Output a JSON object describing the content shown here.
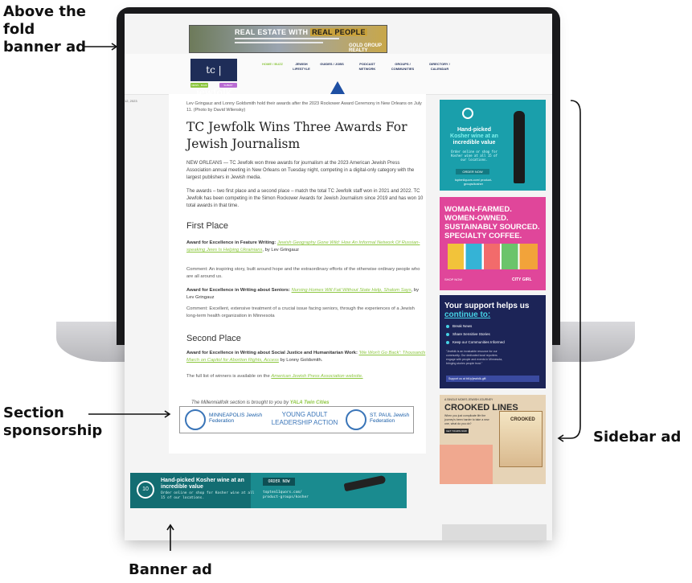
{
  "annotations": {
    "above_fold": "Above the fold banner ad",
    "section_sponsorship": "Section sponsorship",
    "sidebar_ad": "Sidebar ad",
    "banner_ad": "Banner ad"
  },
  "top_banner": {
    "headline_plain": "REAL ESTATE WITH",
    "headline_boxed": "REAL PEOPLE",
    "brand": "GOLD GROUP REALTY"
  },
  "site": {
    "logo_text": "tc | jewfolk",
    "nav": [
      {
        "label": "HOME / BUZZ"
      },
      {
        "label": "JEWISH LIFESTYLE"
      },
      {
        "label": "GUIDES / JOBS"
      },
      {
        "label": "PODCAST NETWORK"
      },
      {
        "label": "GROUPS / COMMUNITIES"
      },
      {
        "label": "DIRECTORY / CALENDAR"
      }
    ],
    "pill_green": "NEWS · BUZZ",
    "pill_purple": "SUBMIT"
  },
  "article": {
    "date": "12, 2023",
    "caption": "Lev Gringauz and Lonny Goldsmith hold their awards after the 2023 Rockower Award Ceremony in New Orleans on July 11. (Photo by David Wilensky)",
    "headline": "TC Jewfolk Wins Three Awards For Jewish Journalism",
    "p1": "NEW ORLEANS — TC Jewfolk won three awards for journalism at the 2023 American Jewish Press Association annual meeting in New Orleans on Tuesday night, competing in a digital-only category with the largest publishers in Jewish media.",
    "p2": "The awards – two first place and a second place – match the total TC Jewfolk staff won in 2021 and 2022. TC Jewfolk has been competing in the Simon Rockower Awards for Jewish Journalism since 2019 and has won 10 total awards in that time.",
    "first_place": "First Place",
    "award1_label": "Award for Excellence in Feature Writing:",
    "award1_link": "Jewish Geography Gone Wild: How An Informal Network Of Russian-speaking Jews Is Helping Ukrainians",
    "award1_by": ", by Lev Gringauz",
    "comment1": "Comment: An inspiring story, built around hope and the extraordinary efforts of the otherwise ordinary people who are all around us.",
    "award2_label": "Award for Excellence in Writing about Seniors:",
    "award2_link": "Nursing Homes Will Fail Without State Help, Shalom Says",
    "award2_by": ", by Lev Gringauz",
    "comment2": "Comment: Excellent, extensive treatment of a crucial issue facing seniors, through the experiences of a Jewish long-term health organization in Minnesota",
    "second_place": "Second Place",
    "award3_label": "Award for Excellence in Writing about Social Justice and Humanitarian Work:",
    "award3_link": "'We Won't Go Back': Thousands March on Capitol for Abortion Rights, Access",
    "award3_by": " by Lonny Goldsmith.",
    "full_list_pre": "The full list of winners is available on the ",
    "full_list_link": "American Jewish Press Association website."
  },
  "sponsor": {
    "line_pre": "The Millennialfolk section is brought to you by ",
    "line_name": "YALA Twin Cities",
    "left_name": "MINNEAPOLIS Jewish Federation",
    "center": "YOUNG ADULT LEADERSHIP ACTION",
    "right_name": "ST. PAUL Jewish Federation"
  },
  "bottom_banner": {
    "circle": "10",
    "headline": "Hand-picked Kosher wine at an incredible value",
    "sub": "Order online or shop for Kosher wine at all 15 of our locations.",
    "button": "ORDER NOW",
    "url": "topten11quors.com/ product-groups/kosher"
  },
  "sidebar": {
    "ad1": {
      "headline": "Hand-picked",
      "headline2": "Kosher wine at an",
      "headline3": "incredible value",
      "sub": "Order online or shop for Kosher wine at all 15 of our locations.",
      "button": "ORDER NOW",
      "url": "toptenliquors.com/ product-groups/kosher"
    },
    "ad2": {
      "headline": "WOMAN-FARMED. WOMEN-OWNED. SUSTAINABLY SOURCED. SPECIALTY COFFEE.",
      "footer_left": "SHOP NOW",
      "footer_right": "CITY GIRL"
    },
    "ad3": {
      "headline_a": "Your support helps us",
      "headline_b": "continue to:",
      "items": [
        "Break News",
        "Share Sensitive Stories",
        "Keep our Communities Informed"
      ],
      "quote": "\"Jewfolk is an invaluable resource for our community. Our dedicated local reporters engage with people and events in Minnesota, bringing stories people trust.\"",
      "cta": "Support us at bit.ly/jewfolk-gift"
    },
    "ad4": {
      "kicker": "A SINGLE MOM'S JEWISH JOURNEY",
      "headline": "CROOKED LINES",
      "sub": "When you just complicate life the journey's been harder to take a new one, what do you do?",
      "button": "GET YOURS NOW",
      "book_title": "CROOKED"
    }
  }
}
